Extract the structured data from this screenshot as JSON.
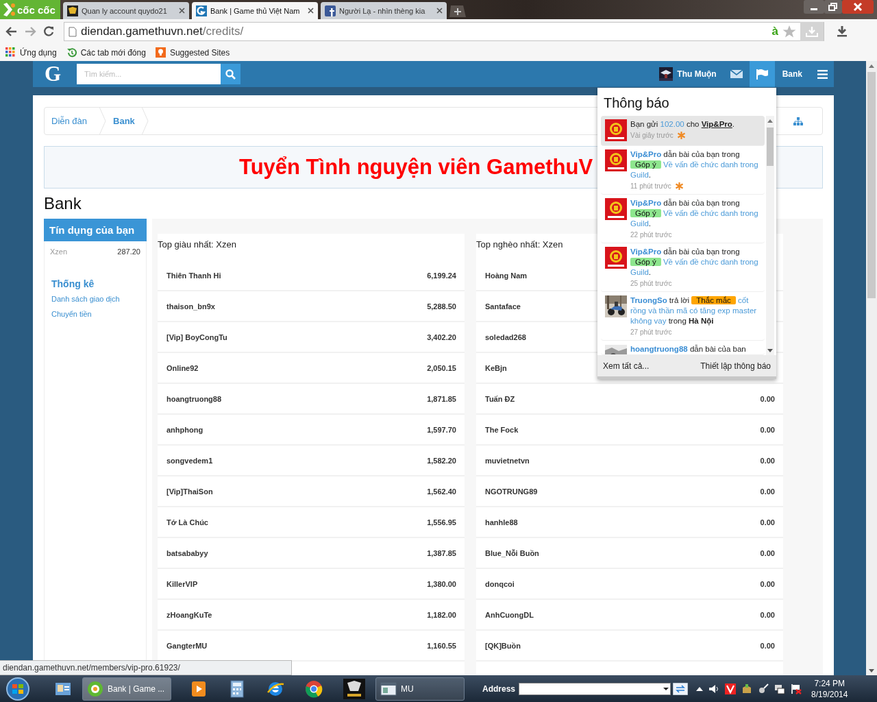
{
  "browser": {
    "brand": "cốc cốc",
    "tabs": [
      {
        "title": "Quan ly account quydo21",
        "selected": false
      },
      {
        "title": "Bank | Game thủ Việt Nam",
        "selected": true
      },
      {
        "title": "Người Lạ - nhìn thèng kia",
        "selected": false
      }
    ],
    "address": {
      "host": "diendan.gamethuvn.net",
      "path": "/credits/"
    },
    "address_badge": "à",
    "bookmarks": [
      {
        "label": "Ứng dụng",
        "kind": "apps"
      },
      {
        "label": "Các tab mới đóng",
        "kind": "history"
      },
      {
        "label": "Suggested Sites",
        "kind": "suggested"
      }
    ]
  },
  "header": {
    "logo": "G",
    "search": {
      "placeholder": "Tìm kiếm..."
    },
    "user": "Thu Muộn",
    "nav": [
      {
        "kind": "mail",
        "selected": false
      },
      {
        "kind": "alerts",
        "selected": true
      },
      {
        "kind": "text",
        "label": "Bank",
        "selected": false
      },
      {
        "kind": "menu",
        "selected": false
      }
    ]
  },
  "breadcrumb": [
    {
      "label": "Diễn đàn",
      "current": false
    },
    {
      "label": "Bank",
      "current": true
    }
  ],
  "banner": "Tuyển Tình nguyện viên GamethuV",
  "title": "Bank",
  "sidebar": {
    "heading": "Tín dụng của bạn",
    "account": {
      "name": "Xzen",
      "balance": "287.20"
    },
    "section": "Thống kê",
    "links": [
      "Danh sách giao dịch",
      "Chuyển tiền"
    ]
  },
  "richest": {
    "title": "Top giàu nhất: Xzen",
    "rows": [
      {
        "name": "Thiên Thanh Hi",
        "value": "6,199.24"
      },
      {
        "name": "thaison_bn9x",
        "value": "5,288.50"
      },
      {
        "name": "[Vip] BoyCongTu",
        "value": "3,402.20"
      },
      {
        "name": "Online92",
        "value": "2,050.15"
      },
      {
        "name": "hoangtruong88",
        "value": "1,871.85"
      },
      {
        "name": "anhphong",
        "value": "1,597.70"
      },
      {
        "name": "songvedem1",
        "value": "1,582.20"
      },
      {
        "name": "[Vip]ThaiSon",
        "value": "1,562.40"
      },
      {
        "name": "Tớ Là Chúc",
        "value": "1,556.95"
      },
      {
        "name": "batsababyy",
        "value": "1,387.85"
      },
      {
        "name": "KillerVIP",
        "value": "1,380.00"
      },
      {
        "name": "zHoangKuTe",
        "value": "1,182.00"
      },
      {
        "name": "GangterMU",
        "value": "1,160.55"
      }
    ]
  },
  "poorest": {
    "title": "Top nghèo nhất: Xzen",
    "rows": [
      {
        "name": "Hoàng Nam"
      },
      {
        "name": "Santaface"
      },
      {
        "name": "soledad268"
      },
      {
        "name": "KeBjn"
      },
      {
        "name": "Tuấn ĐZ",
        "value": "0.00"
      },
      {
        "name": "The Fock",
        "value": "0.00"
      },
      {
        "name": "muvietnetvn",
        "value": "0.00"
      },
      {
        "name": "NGOTRUNG89",
        "value": "0.00"
      },
      {
        "name": "hanhle88",
        "value": "0.00"
      },
      {
        "name": "Blue_Nỗi Buồn",
        "value": "0.00"
      },
      {
        "name": "donqcoi",
        "value": "0.00"
      },
      {
        "name": "AnhCuongDL",
        "value": "0.00"
      },
      {
        "name": "[QK]Buồn",
        "value": "0.00"
      }
    ]
  },
  "notifications": {
    "title": "Thông báo",
    "items": [
      {
        "highlighted": true,
        "unread": true,
        "time": "Vài giây trước",
        "parts": [
          {
            "kind": "plain",
            "text": "Bạn gửi "
          },
          {
            "kind": "link",
            "text": "102.00"
          },
          {
            "kind": "plain",
            "text": " cho "
          },
          {
            "kind": "user-dark",
            "text": "Vip&Pro"
          },
          {
            "kind": "plain",
            "text": "."
          }
        ]
      },
      {
        "highlighted": false,
        "unread": true,
        "time": "11 phút trước",
        "parts": [
          {
            "kind": "user",
            "text": "Vip&Pro"
          },
          {
            "kind": "plain",
            "text": " dẫn bài của bạn trong "
          },
          {
            "kind": "tag",
            "text": "Góp ý",
            "color": "#8ee68e"
          },
          {
            "kind": "link",
            "text": " Về vấn đề chức danh trong Guild"
          },
          {
            "kind": "plain",
            "text": "."
          }
        ]
      },
      {
        "highlighted": false,
        "unread": false,
        "time": "22 phút trước",
        "parts": [
          {
            "kind": "user",
            "text": "Vip&Pro"
          },
          {
            "kind": "plain",
            "text": " dẫn bài của bạn trong "
          },
          {
            "kind": "tag",
            "text": "Góp ý",
            "color": "#8ee68e"
          },
          {
            "kind": "link",
            "text": " Về vấn đề chức danh trong Guild"
          },
          {
            "kind": "plain",
            "text": "."
          }
        ]
      },
      {
        "highlighted": false,
        "unread": false,
        "time": "25 phút trước",
        "parts": [
          {
            "kind": "user",
            "text": "Vip&Pro"
          },
          {
            "kind": "plain",
            "text": " dẫn bài của bạn trong "
          },
          {
            "kind": "tag",
            "text": "Góp ý",
            "color": "#8ee68e"
          },
          {
            "kind": "link",
            "text": " Về vấn đề chức danh trong Guild"
          },
          {
            "kind": "plain",
            "text": "."
          }
        ]
      },
      {
        "highlighted": false,
        "unread": false,
        "time": "27 phút trước",
        "parts": [
          {
            "kind": "user",
            "text": "TruongSo"
          },
          {
            "kind": "plain",
            "text": " trả lời "
          },
          {
            "kind": "tag",
            "text": "Thắc mắc",
            "color": "#ffa500"
          },
          {
            "kind": "link",
            "text": " cốt rồng và thần mã có tăng exp master không vay"
          },
          {
            "kind": "plain",
            "text": " trong "
          },
          {
            "kind": "bold",
            "text": "Hà Nội"
          }
        ]
      },
      {
        "highlighted": false,
        "unread": false,
        "parts": [
          {
            "kind": "user",
            "text": "hoangtruong88"
          },
          {
            "kind": "plain",
            "text": " dẫn bài của ban"
          }
        ]
      }
    ],
    "footer": [
      "Xem tất cả...",
      "Thiết lập thông báo"
    ]
  },
  "status_url": "diendan.gamethuvn.net/members/vip-pro.61923/",
  "taskbar": {
    "items": [
      {
        "kind": "contacts"
      },
      {
        "kind": "window",
        "label": "Bank | Game ...",
        "selected": true
      },
      {
        "kind": "media"
      },
      {
        "kind": "calculator"
      },
      {
        "kind": "globe"
      },
      {
        "kind": "browser"
      },
      {
        "kind": "game"
      },
      {
        "kind": "window",
        "label": "MU",
        "selected": false
      }
    ],
    "address_label": "Address",
    "time": "7:24 PM",
    "date": "8/19/2014"
  }
}
